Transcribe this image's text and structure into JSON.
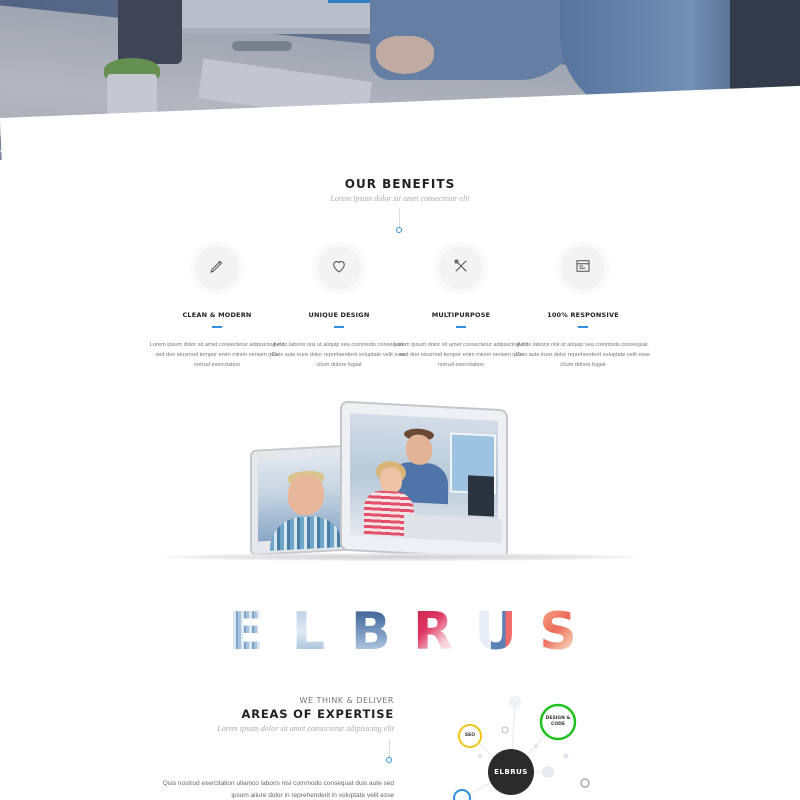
{
  "benefits": {
    "title": "OUR BENEFITS",
    "subtitle": "Lorem ipsum dolor sit amet consectetur elit",
    "items": [
      {
        "icon": "pencil-icon",
        "title": "CLEAN & MODERN",
        "text": "Lorem ipsum dolor sit amet consectetur adipisicing elit sed don eiusmod tempor enim minim veniam quis notrud exercitation"
      },
      {
        "icon": "heart-icon",
        "title": "UNIQUE DESIGN",
        "text": "Amco laboris nisi ut aliquip xea commodo consequat. Duis aute irure dolor reprehenderit voluptate velit esse cilum dolore fugiat"
      },
      {
        "icon": "tools-icon",
        "title": "MULTIPURPOSE",
        "text": "Lorem ipsum dolor sit amet consectetur adipisicing elit sed don eiusmod tempor enim minim veniam quis notrud exercitation"
      },
      {
        "icon": "browser-icon",
        "title": "100% RESPONSIVE",
        "text": "Amco laboris nisi ut aliquip xea commodo consequat. Duis aute irure dolor reprehenderit voluptate velit esse cilum dolore fugiat"
      }
    ]
  },
  "brand": {
    "letters": [
      "E",
      "L",
      "B",
      "R",
      "U",
      "S"
    ]
  },
  "expertise": {
    "kicker": "WE THINK & DELIVER",
    "title": "AREAS OF EXPERTISE",
    "subtitle": "Lorem ipsum dolor sit amet consectetur adipisicing elit",
    "text": "Quis nostrud exercitation ullamco laboris nisi commodo consequat duis aute sed ipsum aiiure dolor in reprehenderit in voluptate velit esse",
    "diagram": {
      "center": "ELBRUS",
      "nodes": [
        {
          "label": "DESIGN & CODE",
          "color": "#1fc11f"
        },
        {
          "label": "SEO",
          "color": "#f0c419"
        }
      ]
    }
  },
  "colors": {
    "accent": "#2d8fe0",
    "heading": "#222222"
  }
}
